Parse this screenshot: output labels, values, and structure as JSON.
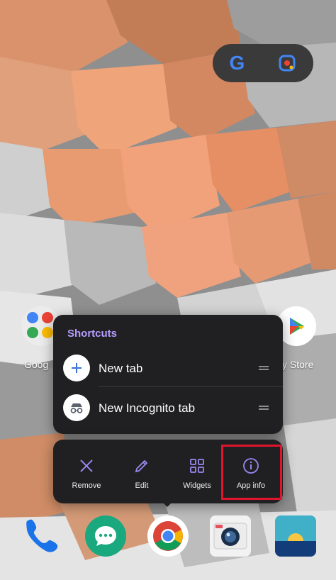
{
  "shortcuts": {
    "title": "Shortcuts",
    "items": [
      {
        "label": "New tab",
        "icon": "plus-icon"
      },
      {
        "label": "New Incognito tab",
        "icon": "incognito-icon"
      }
    ]
  },
  "actions": [
    {
      "label": "Remove",
      "icon": "close-icon"
    },
    {
      "label": "Edit",
      "icon": "pencil-icon"
    },
    {
      "label": "Widgets",
      "icon": "grid-icon"
    },
    {
      "label": "App info",
      "icon": "info-icon"
    }
  ],
  "home": {
    "google_label": "Goog",
    "play_label": "y Store"
  },
  "search_pill": {
    "g_letter": "G"
  },
  "colors": {
    "accent": "#b59cff",
    "popup_bg": "#202022",
    "highlight": "#e0142c",
    "icon_purple": "#9b86f0"
  }
}
